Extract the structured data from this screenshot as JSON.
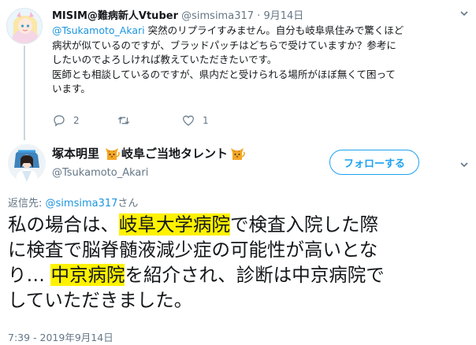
{
  "parent_tweet": {
    "display_name": "MISIM@難病新人Vtuber",
    "handle": "@simsima317",
    "separator": "·",
    "date": "9月14日",
    "body_lines": [
      {
        "mention": "@Tsukamoto_Akari",
        "text": " 突然のリプライすみません。自分も岐阜県住みで驚くほど"
      },
      {
        "mention": "",
        "text": "病状が似ているのですが、ブラッドパッチはどちらで受けていますか？参考に"
      },
      {
        "mention": "",
        "text": "したいのでよろしければ教えていただきたいです。"
      },
      {
        "mention": "",
        "text": "医師とも相談しているのですが、県内だと受けられる場所がほぼ無くて困って"
      },
      {
        "mention": "",
        "text": "います。"
      }
    ],
    "actions": {
      "reply_icon": "reply-icon",
      "reply_count": "2",
      "retweet_icon": "retweet-icon",
      "like_icon": "heart-icon",
      "like_count": "1"
    }
  },
  "main_tweet": {
    "display_name_prefix": "塚本明里",
    "display_name_middle": "岐阜ご当地タレント",
    "handle": "@Tsukamoto_Akari",
    "follow_label": "フォローする",
    "reply_to_label": "返信先: ",
    "reply_to_mention": "@simsima317",
    "reply_to_suffix": "さん",
    "body_lines": [
      [
        {
          "text": "私の場合は、",
          "hl": false
        },
        {
          "text": "岐阜大学病院",
          "hl": true
        },
        {
          "text": "で検査入院した際",
          "hl": false
        }
      ],
      [
        {
          "text": "に検査で脳脊髄液減少症の可能性が高いとな",
          "hl": false
        }
      ],
      [
        {
          "text": "り… ",
          "hl": false
        },
        {
          "text": "中京病院",
          "hl": true
        },
        {
          "text": "を紹介され、診断は中京病院で",
          "hl": false
        }
      ],
      [
        {
          "text": "していただきました。",
          "hl": false
        }
      ]
    ],
    "timestamp": "7:39 - 2019年9月14日",
    "emoji_icon": "cat-emoji-icon"
  },
  "colors": {
    "accent": "#1da1f2",
    "mention": "#1b95e0",
    "secondary_text": "#657786",
    "highlight": "#fff200",
    "thread_line": "#ccd6dd"
  }
}
